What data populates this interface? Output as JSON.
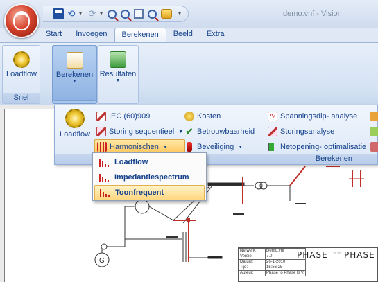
{
  "window": {
    "title": "demo.vnf - Vision"
  },
  "tabs": [
    {
      "label": "Start"
    },
    {
      "label": "Invoegen"
    },
    {
      "label": "Berekenen",
      "active": true
    },
    {
      "label": "Beeld"
    },
    {
      "label": "Extra"
    }
  ],
  "ribbon": {
    "group_snel": {
      "label": "Snel",
      "loadflow_label": "Loadflow"
    },
    "berekenen_label": "Berekenen",
    "resultaten_label": "Resultaten"
  },
  "panel": {
    "loadflow_label": "Loadflow",
    "group_label": "Berekenen",
    "col1": [
      "IEC (60)909",
      "Storing sequentieel",
      "Harmonischen"
    ],
    "col2": [
      "Kosten",
      "Betrouwbaarheid",
      "Beveiliging"
    ],
    "col3": [
      "Spanningsdip- analyse",
      "Storingsanalyse",
      "Netopening- optimalisatie"
    ]
  },
  "menu": {
    "items": [
      "Loadflow",
      "Impedantiespectrum",
      "Toonfrequent"
    ],
    "hovered": "Toonfrequent"
  },
  "title_block": {
    "rows": [
      [
        "Netwerk:",
        "Demo.vnf"
      ],
      [
        "Versie:",
        "7.0"
      ],
      [
        "Datum:",
        "26-1-2010"
      ],
      [
        "Tijd:",
        "15:56:25"
      ],
      [
        "Auteur:",
        "Phase to Phase B.V."
      ]
    ],
    "logo_left": "PHASE",
    "logo_right": "PHASE"
  },
  "colors": {
    "accent": "#15428b",
    "highlight": "#ffc55a",
    "ribbon": "#dfe8f4"
  }
}
